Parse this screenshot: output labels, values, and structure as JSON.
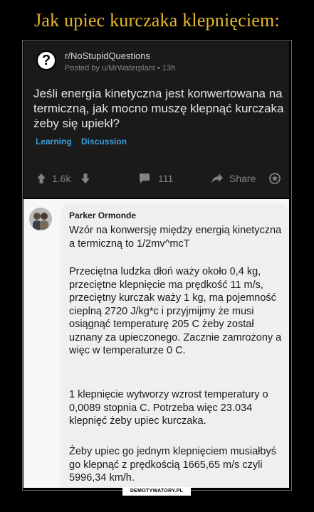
{
  "page_title": "Jak upiec kurczaka klepnięciem:",
  "post": {
    "subreddit": "r/NoStupidQuestions",
    "posted_by": "Posted by u/MrWaterplant • 13h",
    "title": "Jeśli energia kinetyczna jest konwertowana na termiczną, jak mocno muszę klepnąć kurczaka żeby się upiekł?",
    "flairs": [
      "Learning",
      "Discussion"
    ],
    "upvotes": "1.6k",
    "comments": "111",
    "share_label": "Share",
    "icons": [
      "question-icon",
      "upvote-icon",
      "downvote-icon",
      "comment-icon",
      "share-icon",
      "award-icon"
    ]
  },
  "comment": {
    "author": "Parker Ormonde",
    "paragraphs": [
      "Wzór na konwersję między energią kinetyczna a termiczną to 1/2mv^mcT",
      "Przeciętna ludzka dłoń waży około 0,4 kg, przeciętne klepnięcie ma prędkość 11 m/s, przeciętny kurczak waży 1 kg, ma pojemność cieplną 2720 J/kg*c i przyjmijmy że musi osiągnąć temperaturę 205 C żeby został uznany za upieczonego. Zacznie zamrożony a więc w temperaturze 0 C.",
      "1 klepnięcie wytworzy wzrost temperatury o 0,0089 stopnia C. Potrzeba więc 23.034 klepnięć żeby upiec kurczaka.",
      "Żeby upiec go jednym klepnięciem musiałbyś go klepnąć z prędkością 1665,65 m/s czyli 5996,34 km/h."
    ]
  },
  "watermark": "DEMOTYWATORY.PL"
}
